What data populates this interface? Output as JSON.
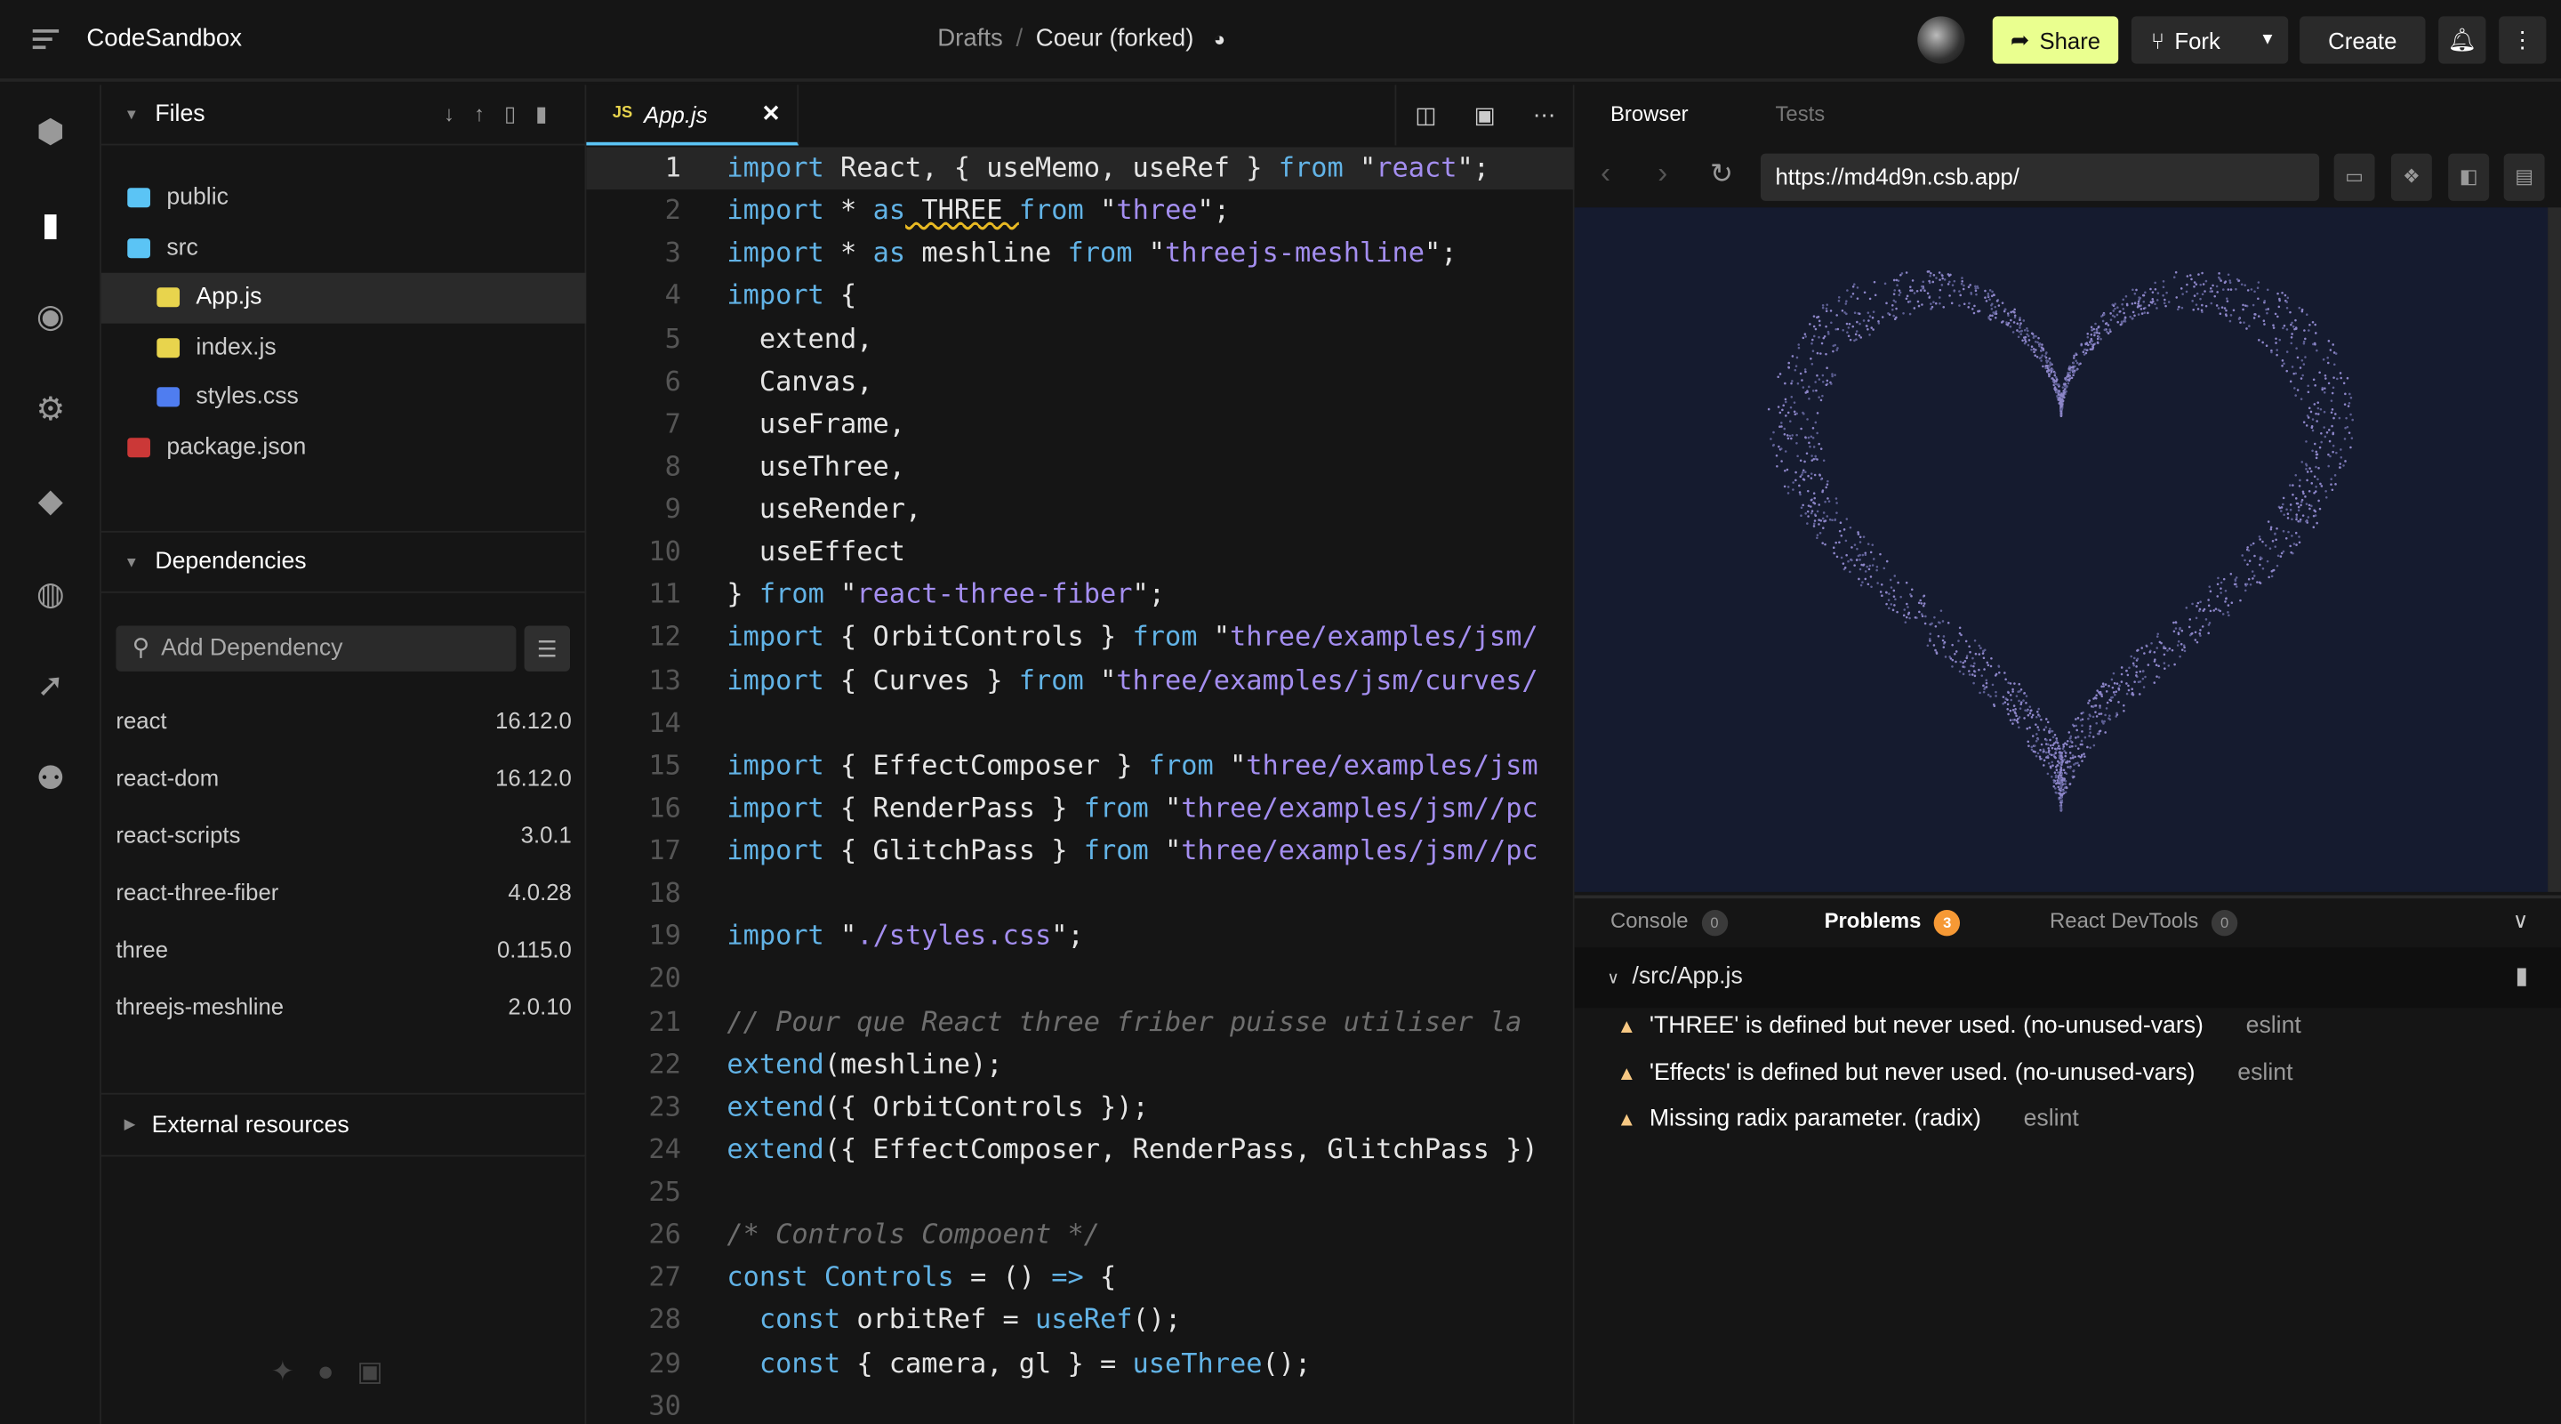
{
  "header": {
    "brand": "CodeSandbox",
    "crumb_folder": "Drafts",
    "crumb_sep": "/",
    "sandbox_name": "Coeur (forked)",
    "share": "Share",
    "fork": "Fork",
    "create": "Create",
    "accent": "#eaff8f"
  },
  "activity": [
    "cube-icon",
    "file-icon",
    "search-icon",
    "gear-icon",
    "github-icon",
    "chat-icon",
    "rocket-icon",
    "users-icon"
  ],
  "files": {
    "title": "Files",
    "items": [
      {
        "name": "public",
        "type": "folder"
      },
      {
        "name": "src",
        "type": "folder-open"
      },
      {
        "name": "App.js",
        "type": "js",
        "selected": true
      },
      {
        "name": "index.js",
        "type": "js"
      },
      {
        "name": "styles.css",
        "type": "css"
      },
      {
        "name": "package.json",
        "type": "npm"
      }
    ]
  },
  "dependencies": {
    "title": "Dependencies",
    "placeholder": "Add Dependency",
    "items": [
      {
        "name": "react",
        "version": "16.12.0"
      },
      {
        "name": "react-dom",
        "version": "16.12.0"
      },
      {
        "name": "react-scripts",
        "version": "3.0.1"
      },
      {
        "name": "react-three-fiber",
        "version": "4.0.28"
      },
      {
        "name": "three",
        "version": "0.115.0"
      },
      {
        "name": "threejs-meshline",
        "version": "2.0.10"
      }
    ]
  },
  "external": {
    "title": "External resources"
  },
  "editor": {
    "tab_badge": "JS",
    "tab": "App.js",
    "lines": [
      [
        [
          "k",
          "import"
        ],
        [
          "t",
          " React, { useMemo, useRef } "
        ],
        [
          "k",
          "from"
        ],
        [
          "t",
          " \""
        ],
        [
          "s",
          "react"
        ],
        [
          "t",
          "\";"
        ]
      ],
      [
        [
          "k",
          "import"
        ],
        [
          "t",
          " * "
        ],
        [
          "k",
          "as"
        ],
        [
          "t",
          " THREE "
        ],
        [
          "k",
          "from"
        ],
        [
          "t",
          " \""
        ],
        [
          "s",
          "three"
        ],
        [
          "t",
          "\";"
        ]
      ],
      [
        [
          "k",
          "import"
        ],
        [
          "t",
          " * "
        ],
        [
          "k",
          "as"
        ],
        [
          "t",
          " meshline "
        ],
        [
          "k",
          "from"
        ],
        [
          "t",
          " \""
        ],
        [
          "s",
          "threejs-meshline"
        ],
        [
          "t",
          "\";"
        ]
      ],
      [
        [
          "k",
          "import"
        ],
        [
          "t",
          " {"
        ]
      ],
      [
        [
          "t",
          "  extend,"
        ]
      ],
      [
        [
          "t",
          "  Canvas,"
        ]
      ],
      [
        [
          "t",
          "  useFrame,"
        ]
      ],
      [
        [
          "t",
          "  useThree,"
        ]
      ],
      [
        [
          "t",
          "  useRender,"
        ]
      ],
      [
        [
          "t",
          "  useEffect"
        ]
      ],
      [
        [
          "t",
          "} "
        ],
        [
          "k",
          "from"
        ],
        [
          "t",
          " \""
        ],
        [
          "s",
          "react-three-fiber"
        ],
        [
          "t",
          "\";"
        ]
      ],
      [
        [
          "k",
          "import"
        ],
        [
          "t",
          " { OrbitControls } "
        ],
        [
          "k",
          "from"
        ],
        [
          "t",
          " \""
        ],
        [
          "s",
          "three/examples/jsm/"
        ]
      ],
      [
        [
          "k",
          "import"
        ],
        [
          "t",
          " { Curves } "
        ],
        [
          "k",
          "from"
        ],
        [
          "t",
          " \""
        ],
        [
          "s",
          "three/examples/jsm/curves/"
        ]
      ],
      [],
      [
        [
          "k",
          "import"
        ],
        [
          "t",
          " { EffectComposer } "
        ],
        [
          "k",
          "from"
        ],
        [
          "t",
          " \""
        ],
        [
          "s",
          "three/examples/jsm"
        ]
      ],
      [
        [
          "k",
          "import"
        ],
        [
          "t",
          " { RenderPass } "
        ],
        [
          "k",
          "from"
        ],
        [
          "t",
          " \""
        ],
        [
          "s",
          "three/examples/jsm//pc"
        ]
      ],
      [
        [
          "k",
          "import"
        ],
        [
          "t",
          " { GlitchPass } "
        ],
        [
          "k",
          "from"
        ],
        [
          "t",
          " \""
        ],
        [
          "s",
          "three/examples/jsm//pc"
        ]
      ],
      [],
      [
        [
          "k",
          "import"
        ],
        [
          "t",
          " \""
        ],
        [
          "s",
          "./styles.css"
        ],
        [
          "t",
          "\";"
        ]
      ],
      [],
      [
        [
          "c",
          "// Pour que React three friber puisse utiliser la"
        ]
      ],
      [
        [
          "f",
          "extend"
        ],
        [
          "t",
          "(meshline);"
        ]
      ],
      [
        [
          "f",
          "extend"
        ],
        [
          "t",
          "({ OrbitControls });"
        ]
      ],
      [
        [
          "f",
          "extend"
        ],
        [
          "t",
          "({ EffectComposer, RenderPass, GlitchPass })"
        ]
      ],
      [],
      [
        [
          "c",
          "/* Controls Compoent */"
        ]
      ],
      [
        [
          "k",
          "const"
        ],
        [
          "t",
          " "
        ],
        [
          "f",
          "Controls"
        ],
        [
          "t",
          " = () "
        ],
        [
          "k",
          "=>"
        ],
        [
          "t",
          " {"
        ]
      ],
      [
        [
          "t",
          "  "
        ],
        [
          "k",
          "const"
        ],
        [
          "t",
          " orbitRef = "
        ],
        [
          "f",
          "useRef"
        ],
        [
          "t",
          "();"
        ]
      ],
      [
        [
          "t",
          "  "
        ],
        [
          "k",
          "const"
        ],
        [
          "t",
          " { camera, gl } = "
        ],
        [
          "f",
          "useThree"
        ],
        [
          "t",
          "();"
        ]
      ],
      []
    ]
  },
  "preview": {
    "tabs": [
      "Browser",
      "Tests"
    ],
    "url": "https://md4d9n.csb.app/",
    "canvas_bg": "#151b2f"
  },
  "devtools": {
    "tabs": [
      {
        "label": "Console",
        "count": "0"
      },
      {
        "label": "Problems",
        "count": "3"
      },
      {
        "label": "React DevTools",
        "count": "0"
      }
    ],
    "file": "/src/App.js",
    "problems": [
      {
        "msg": "'THREE' is defined but never used. (no-unused-vars)",
        "src": "eslint"
      },
      {
        "msg": "'Effects' is defined but never used. (no-unused-vars)",
        "src": "eslint"
      },
      {
        "msg": "Missing radix parameter. (radix)",
        "src": "eslint"
      }
    ]
  }
}
